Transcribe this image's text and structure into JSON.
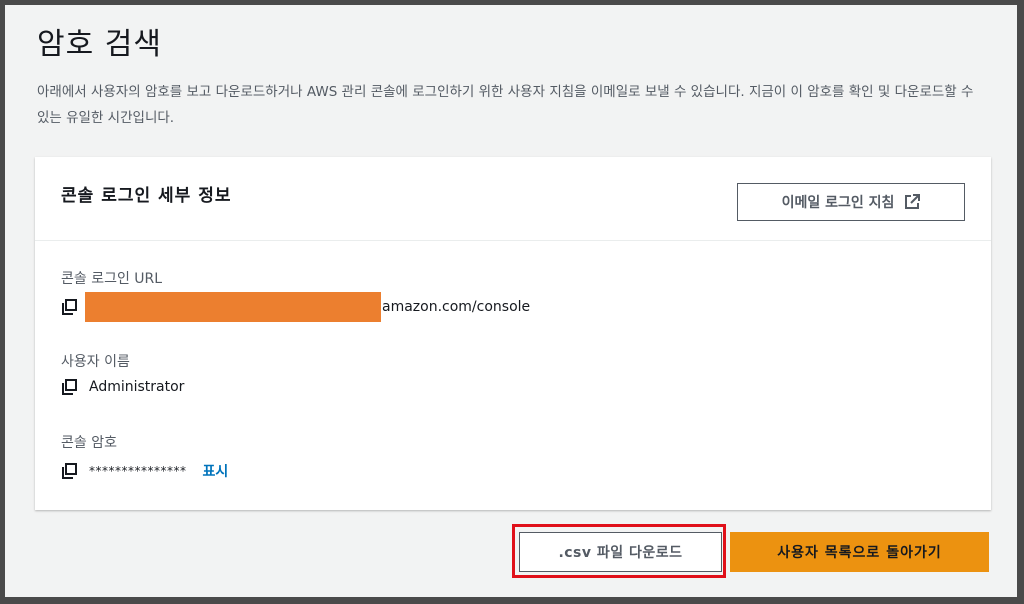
{
  "page": {
    "title": "암호 검색",
    "description": "아래에서 사용자의 암호를 보고 다운로드하거나 AWS 관리 콘솔에 로그인하기 위한 사용자 지침을 이메일로 보낼 수 있습니다. 지금이 이 암호를 확인 및 다운로드할 수 있는 유일한 시간입니다."
  },
  "card": {
    "title": "콘솔 로그인 세부 정보",
    "email_button": "이메일 로그인 지침",
    "email_button_icon": "external-link-icon",
    "url_label": "콘솔 로그인 URL",
    "url_value_visible": "amazon.com/console",
    "username_label": "사용자 이름",
    "username_value": "Administrator",
    "password_label": "콘솔 암호",
    "password_value": "***************",
    "show_link": "표시"
  },
  "actions": {
    "download_csv": ".csv 파일 다운로드",
    "back_to_users": "사용자 목록으로 돌아가기"
  },
  "colors": {
    "primary_button": "#ec9210",
    "link": "#0073bb",
    "redaction": "#ec7f2f",
    "highlight_border": "#e0101a"
  }
}
